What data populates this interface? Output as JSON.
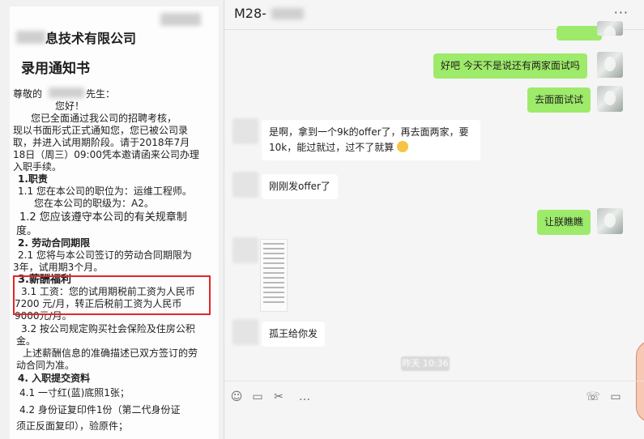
{
  "letter": {
    "company_name": "息技术有限公司",
    "title": "录用通知书",
    "salutation": "尊敬的",
    "salutation_suffix": "先生：",
    "greeting": "您好！",
    "intro_lines": [
      "您已全面通过我公司的招聘考核，",
      "现以书面形式正式通知您，您已被公司录",
      "取，并进入试用期阶段。请于2018年7月",
      "18日（周三）09:00凭本邀请函来公司办理",
      "入职手续。"
    ],
    "section1_title": "1.职责",
    "s1_1a": "1.1  您在本公司的职位为：运维工程师。",
    "s1_1b": "您在本公司的职级为：A2。",
    "s1_2a": "1.2  您应该遵守本公司的有关规章制",
    "s1_2b": "度。",
    "section2_title": "2. 劳动合同期限",
    "s2_1a": "2.1  您将与本公司签订的劳动合同期限为",
    "s2_1b": "3年，试用期3个月。",
    "section3_title": "3.薪酬福利",
    "s3_1a": "3.1 工资：您的试用期税前工资为人民币",
    "s3_1b": "7200 元/月，转正后税前工资为人民币",
    "s3_1c": "9000元/月。",
    "s3_2a": "3.2 按公司规定购买社会保险及住房公积",
    "s3_2b": "金。",
    "s3_3a": "上述薪酬信息的准确描述已双方签订的劳",
    "s3_3b": "动合同为准。",
    "section4_title": "4. 入职提交资料",
    "s4_1": "4.1 一寸红(蓝)底照1张；",
    "s4_2a": "4.2 身份证复印件1份（第二代身份证",
    "s4_2b": "须正反面复印），验原件；"
  },
  "chat": {
    "title": "M28-",
    "more_label": "···",
    "messages": [
      {
        "side": "me",
        "text": "好吧   今天不是说还有两家面试吗"
      },
      {
        "side": "me",
        "text": "去面面试试"
      },
      {
        "side": "other",
        "text": "是啊，拿到一个9k的offer了，再去面两家，要10k，能过就过，过不了就算"
      },
      {
        "side": "other",
        "text": "刚刚发offer了"
      },
      {
        "side": "me",
        "text": "让朕瞧瞧"
      },
      {
        "side": "other",
        "text": "孤王给你发"
      }
    ],
    "time_label": "昨天 10:36",
    "tools": {
      "emoji": "☺",
      "folder": "▭",
      "scissors": "✂",
      "comment": "…",
      "phone": "☏",
      "video": "▭"
    }
  }
}
